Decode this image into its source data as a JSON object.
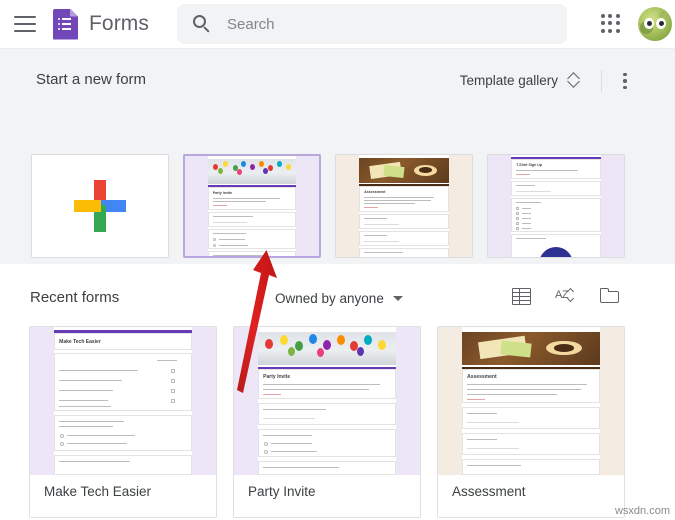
{
  "header": {
    "menu_icon": "hamburger-icon",
    "brand": "Forms",
    "logo_icon": "forms-logo-icon",
    "search": {
      "placeholder": "Search",
      "value": "",
      "icon": "search-icon"
    },
    "apps_icon": "apps-grid-icon",
    "avatar_icon": "account-avatar"
  },
  "templates": {
    "section_title": "Start a new form",
    "gallery_label": "Template gallery",
    "gallery_icon": "chevron-up-down-icon",
    "more_icon": "more-vertical-icon",
    "items": [
      {
        "label": "Blank",
        "kind": "blank",
        "selected": false
      },
      {
        "label": "Party Invite",
        "kind": "party",
        "selected": true
      },
      {
        "label": "Assessment",
        "kind": "assessment",
        "selected": false
      },
      {
        "label": "T-Shirt Sign Up",
        "kind": "tshirt",
        "selected": false
      }
    ]
  },
  "recent": {
    "section_title": "Recent forms",
    "filter_label": "Owned by anyone",
    "filter_icon": "caret-down-icon",
    "list_view_icon": "list-view-icon",
    "sort_icon": "sort-az-icon",
    "folder_icon": "folder-icon",
    "items": [
      {
        "label": "Make Tech Easier",
        "kind": "mte"
      },
      {
        "label": "Party Invite",
        "kind": "party"
      },
      {
        "label": "Assessment",
        "kind": "assessment"
      }
    ]
  },
  "annotation": {
    "type": "red-arrow",
    "points_to": "Party Invite"
  },
  "watermark": "wsxdn.com",
  "colors": {
    "brand_purple": "#7248b9",
    "accent_purple": "#673ab7",
    "selected_border": "#b8a7dd",
    "section_bg": "#f1f3f4",
    "text": "#3c4043",
    "arrow_red": "#d81f1f"
  }
}
